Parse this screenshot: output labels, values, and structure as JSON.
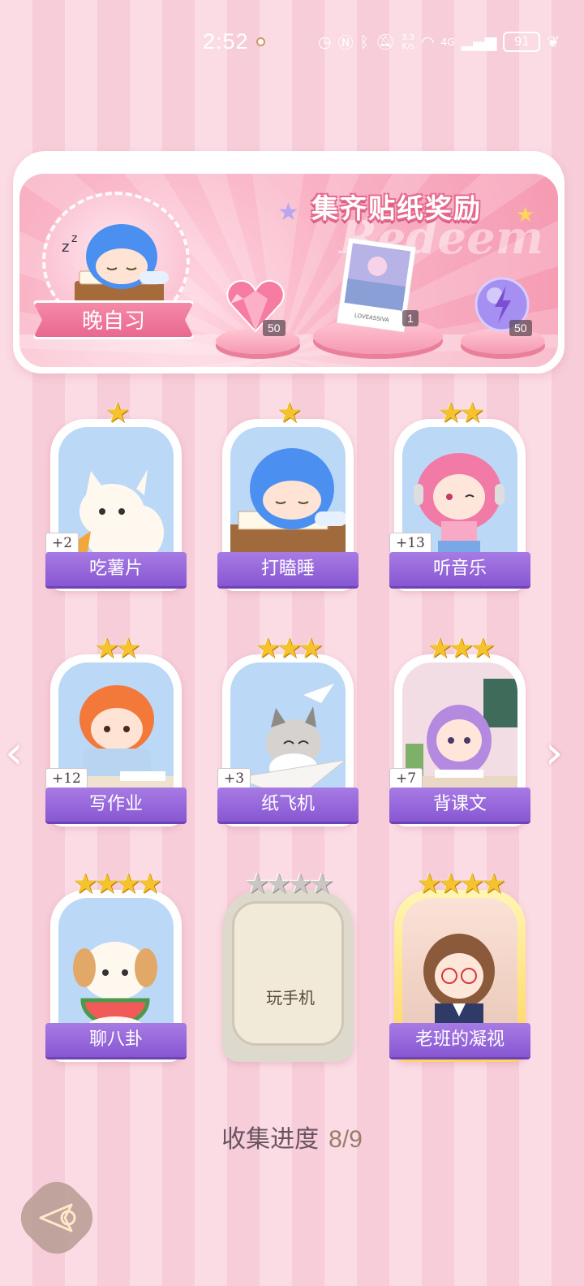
{
  "status_bar": {
    "time": "2:52",
    "network_speed": "3.3\nK/s",
    "network_type": "4G",
    "battery": "91"
  },
  "banner": {
    "title": "集齐贴纸奖励",
    "watermark": "Redeem",
    "level_label": "晚自习",
    "rewards": [
      {
        "name": "heart-gem",
        "count": "50"
      },
      {
        "name": "photo-card",
        "count": "1",
        "caption": "LOVEASSIVA"
      },
      {
        "name": "energy-orb",
        "count": "50"
      }
    ]
  },
  "cards": [
    {
      "label": "吃薯片",
      "stars": "★",
      "badge": "+2",
      "state": "collected"
    },
    {
      "label": "打瞌睡",
      "stars": "★",
      "badge": "",
      "state": "collected"
    },
    {
      "label": "听音乐",
      "stars": "★★",
      "badge": "+13",
      "state": "collected"
    },
    {
      "label": "写作业",
      "stars": "★★",
      "badge": "+12",
      "state": "collected"
    },
    {
      "label": "纸飞机",
      "stars": "★★★",
      "badge": "+3",
      "state": "collected"
    },
    {
      "label": "背课文",
      "stars": "★★★",
      "badge": "+7",
      "state": "collected"
    },
    {
      "label": "聊八卦",
      "stars": "★★★★",
      "badge": "",
      "state": "collected"
    },
    {
      "label": "玩手机",
      "stars": "★★★★",
      "badge": "",
      "state": "locked"
    },
    {
      "label": "老班的凝视",
      "stars": "★★★★",
      "badge": "",
      "state": "gold"
    }
  ],
  "navigation": {
    "prev": "‹",
    "next": "›"
  },
  "progress": {
    "label": "收集进度",
    "value": "8/9"
  },
  "colors": {
    "accent_purple": "#8757d2",
    "banner_pink": "#f59ab2",
    "star_gold": "#f7c32c"
  }
}
